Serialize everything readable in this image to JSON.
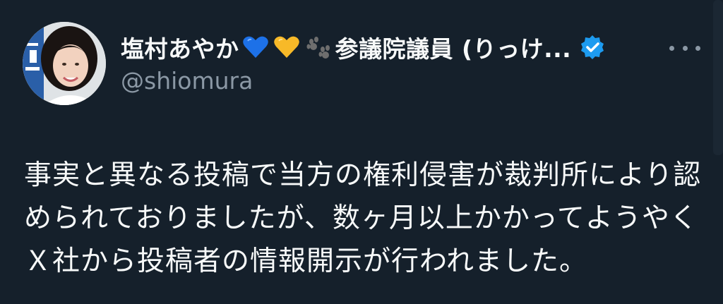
{
  "tweet": {
    "display_name_prefix": "塩村あやか",
    "display_name_rest": "参議院議員 (りっけ...",
    "handle": "@shiomura",
    "verified": true,
    "body": "事実と異なる投稿で当方の権利侵害が裁判所により認められておりましたが、数ヶ月以上かかってようやくＸ社から投稿者の情報開示が行われました。",
    "emoji": [
      "blue-heart-icon",
      "yellow-heart-icon",
      "paw-prints-icon"
    ],
    "more_icon": "more-options-icon",
    "colors": {
      "background": "#15202b",
      "primary_text": "#f7f9f9",
      "secondary_text": "#8b98a5",
      "verified_badge": "#1d9bf0"
    }
  }
}
